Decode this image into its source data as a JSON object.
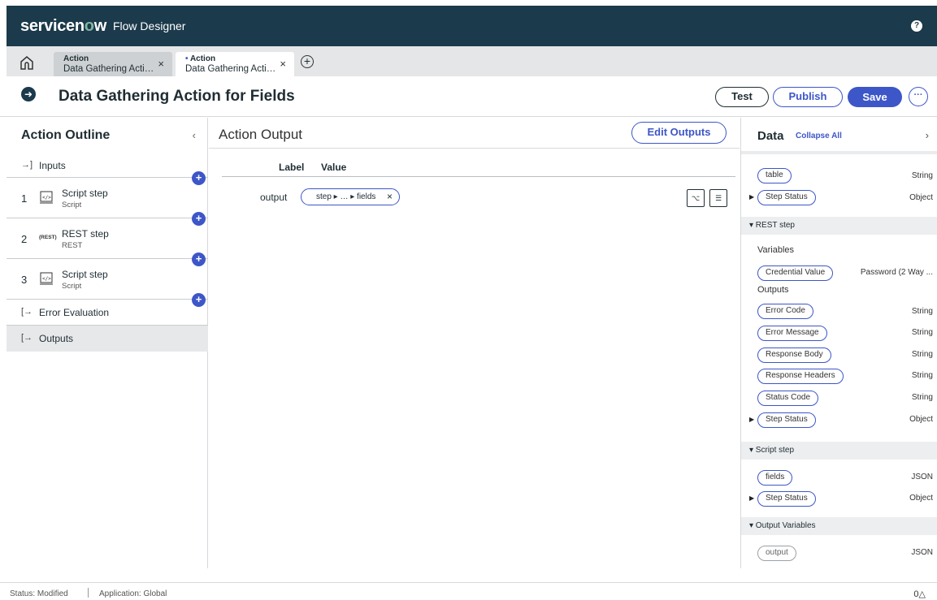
{
  "header": {
    "brand": "servicenow",
    "product": "Flow Designer",
    "help": "?"
  },
  "tabs": [
    {
      "type": "Action",
      "name": "Data Gathering Acti…",
      "close": "×"
    },
    {
      "modified": "•",
      "type": "Action",
      "name": "Data Gathering Acti…",
      "close": "×"
    }
  ],
  "title": "Data Gathering Action for Fields",
  "toolbar": {
    "test": "Test",
    "publish": "Publish",
    "save": "Save",
    "more": "···"
  },
  "outline": {
    "title": "Action Outline",
    "collapse": "‹",
    "inputs": "Inputs",
    "steps": [
      {
        "num": "1",
        "title": "Script step",
        "sub": "Script"
      },
      {
        "num": "2",
        "title": "REST step",
        "sub": "REST",
        "badge": "(REST)"
      },
      {
        "num": "3",
        "title": "Script step",
        "sub": "Script"
      }
    ],
    "error": "Error Evaluation",
    "outputs": "Outputs"
  },
  "output_panel": {
    "title": "Action Output",
    "edit": "Edit Outputs",
    "col_label": "Label",
    "col_value": "Value",
    "row": {
      "label": "output",
      "value": "step ▸ … ▸ fields"
    }
  },
  "data_panel": {
    "title": "Data",
    "collapse_all": "Collapse All",
    "chevron": "›",
    "top_items": [
      {
        "pill": "table",
        "type": "String"
      },
      {
        "pill": "Step Status",
        "type": "Object"
      }
    ],
    "rest_section": "▾ REST step",
    "variables_label": "Variables",
    "credential": {
      "pill": "Credential Value",
      "type": "Password (2 Way ..."
    },
    "outputs_label": "Outputs",
    "rest_outputs": [
      {
        "pill": "Error Code",
        "type": "String"
      },
      {
        "pill": "Error Message",
        "type": "String"
      },
      {
        "pill": "Response Body",
        "type": "String"
      },
      {
        "pill": "Response Headers",
        "type": "String"
      },
      {
        "pill": "Status Code",
        "type": "String"
      },
      {
        "pill": "Step Status",
        "type": "Object"
      }
    ],
    "script_section": "▾ Script step",
    "script_items": [
      {
        "pill": "fields",
        "type": "JSON"
      },
      {
        "pill": "Step Status",
        "type": "Object"
      }
    ],
    "output_vars_section": "▾ Output Variables",
    "output_vars": [
      {
        "pill": "output",
        "type": "JSON"
      }
    ]
  },
  "status": {
    "modified": "Status: Modified",
    "application": "Application: Global",
    "right": "0△"
  }
}
